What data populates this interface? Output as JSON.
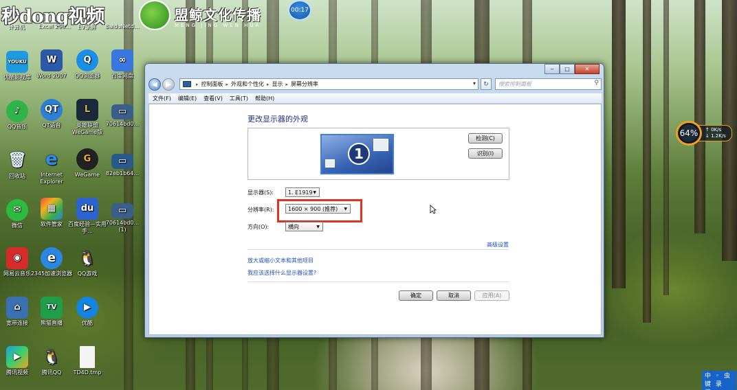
{
  "watermark": {
    "left_text": "秒dong视频",
    "brand_cn": "盟鲸文化传播",
    "brand_py": "MENG JING WEN HUA",
    "timer": "00:17"
  },
  "desktop": {
    "top_labels": [
      "计算机",
      "Excel 200...",
      "EV录屏",
      "BaiduNetd..."
    ],
    "icons": [
      {
        "label": "优酷影视库",
        "color": "#1e9ae0",
        "glyph": "YOUKU"
      },
      {
        "label": "Word 2007",
        "color": "#2b5aa8",
        "glyph": "W"
      },
      {
        "label": "QQ浏览器",
        "color": "#1a8fe8",
        "glyph": "Q"
      },
      {
        "label": "百度网盘",
        "color": "#3a78e0",
        "glyph": "∞"
      },
      {
        "label": "QQ音乐",
        "color": "#2fb44a",
        "glyph": "♪"
      },
      {
        "label": "QT语音",
        "color": "#2b7fd4",
        "glyph": "QT"
      },
      {
        "label": "英雄联盟 WeGame版",
        "color": "#1a2a3a",
        "glyph": "L"
      },
      {
        "label": "70614bd0...",
        "color": "#3a5f8a",
        "glyph": "▭"
      },
      {
        "label": "回收站",
        "color": "#6a8fb4",
        "glyph": "🗑"
      },
      {
        "label": "Internet Explorer",
        "color": "#1f6fd0",
        "glyph": "e"
      },
      {
        "label": "WeGame",
        "color": "#222",
        "glyph": "G"
      },
      {
        "label": "82eb1b64...",
        "color": "#2a5a8a",
        "glyph": "▭"
      },
      {
        "label": "微信",
        "color": "#2dbb3d",
        "glyph": "✉"
      },
      {
        "label": "软件管家",
        "color": "#f08a20",
        "glyph": "▦"
      },
      {
        "label": "百度经验—实用手...",
        "color": "#2c63d1",
        "glyph": "du"
      },
      {
        "label": "70614bd0... (1)",
        "color": "#3a5f8a",
        "glyph": "▭"
      },
      {
        "label": "网易云音乐",
        "color": "#d62b2b",
        "glyph": "◉"
      },
      {
        "label": "2345加速浏览器",
        "color": "#2a88e0",
        "glyph": "e"
      },
      {
        "label": "QQ游戏",
        "color": "#e02a2a",
        "glyph": "🐧"
      },
      {
        "label": "宽带连接",
        "color": "#3a6fb0",
        "glyph": "⌂"
      },
      {
        "label": "熊猫直播",
        "color": "#1f9e4a",
        "glyph": "TV"
      },
      {
        "label": "优酷",
        "color": "#1583e0",
        "glyph": "▶"
      },
      {
        "label": "腾讯视频",
        "color": "#1ba0e0",
        "glyph": "▶"
      },
      {
        "label": "腾讯QQ",
        "color": "#222",
        "glyph": "🐧"
      },
      {
        "label": "TD4D.tmp",
        "color": "#eeeeee",
        "glyph": ""
      }
    ]
  },
  "window": {
    "caption": {
      "minimize": "‒",
      "maximize": "□",
      "close": "✕"
    },
    "breadcrumb": [
      "控制面板",
      "外观和个性化",
      "显示",
      "屏幕分辨率"
    ],
    "search_placeholder": "搜索控制面板",
    "menu": [
      "文件(F)",
      "编辑(E)",
      "查看(V)",
      "工具(T)",
      "帮助(H)"
    ],
    "heading": "更改显示器的外观",
    "monitor_number": "1",
    "detect_button": "检测(C)",
    "identify_button": "识别(I)",
    "display_label": "显示器(S):",
    "display_value": "1. E1919",
    "resolution_label": "分辨率(R):",
    "resolution_value": "1600 × 900 (推荐)",
    "orientation_label": "方向(O):",
    "orientation_value": "横向",
    "advanced_link": "高级设置",
    "link_text_size": "放大或缩小文本和其他项目",
    "link_which": "我应该选择什么显示器设置?",
    "ok_button": "确定",
    "cancel_button": "取消",
    "apply_button": "应用(A)"
  },
  "widget": {
    "percent": "64%",
    "up": "0K/s",
    "down": "1.2K/s"
  },
  "ime": {
    "line1": "中 ◦ 虫",
    "line2": "键 录 弓"
  }
}
